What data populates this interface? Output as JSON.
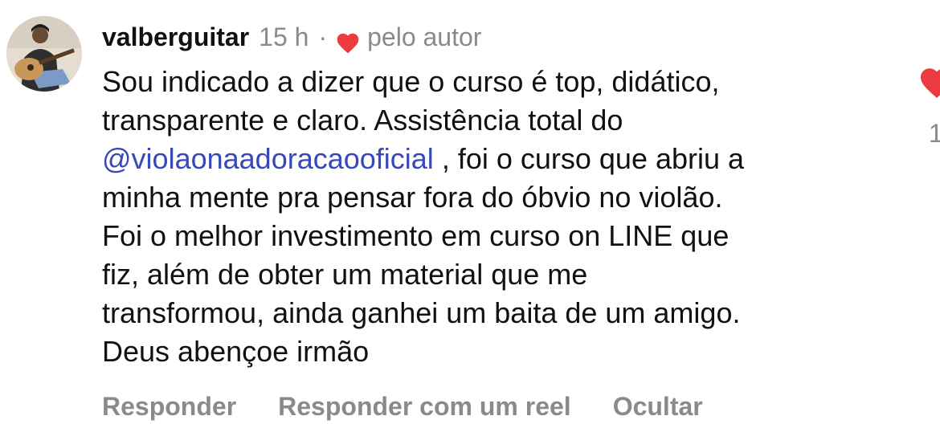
{
  "comment": {
    "username": "valberguitar",
    "time": "15 h",
    "separator": "·",
    "author_label": "pelo autor",
    "text_before_mention": "Sou indicado a dizer que o curso é top, didático,\ntransparente e claro. Assistência total do\n",
    "mention": "@violaonaadoracaooficial",
    "text_after_mention": " , foi o curso que abriu a\nminha mente pra pensar fora do óbvio no violão.\nFoi o melhor investimento em curso on LINE que\nfiz, além de obter um material que me\ntransformou, ainda ganhei um baita de um amigo.\nDeus abençoe irmão",
    "like_count": "1",
    "actions": {
      "reply": "Responder",
      "reply_reel": "Responder com um reel",
      "hide": "Ocultar"
    }
  },
  "icons": {
    "author_heart": "heart-icon",
    "like_heart": "heart-icon"
  },
  "colors": {
    "heart": "#ed3a3f",
    "mention": "#3848b8",
    "secondary_text": "#8a8a8a"
  }
}
